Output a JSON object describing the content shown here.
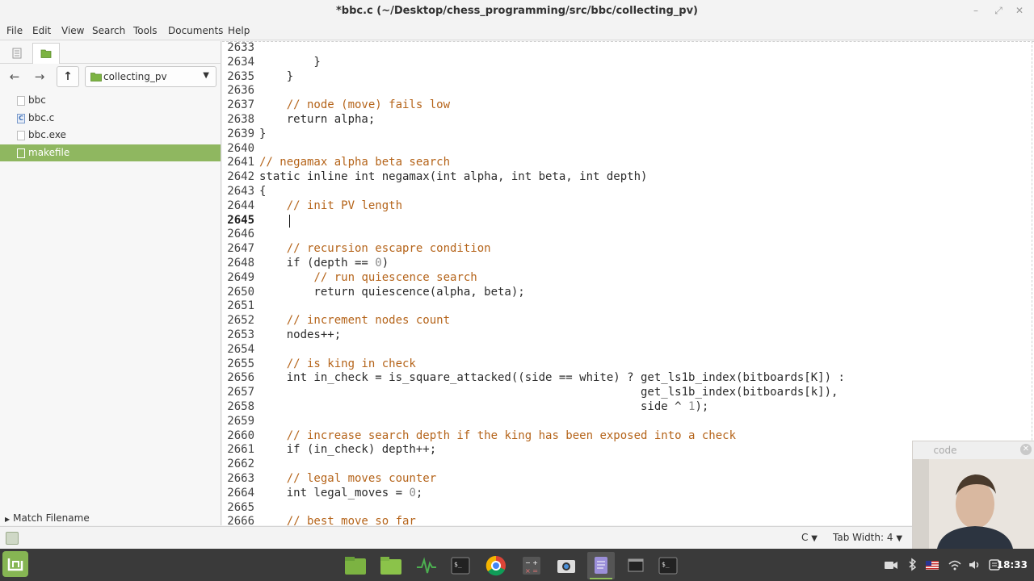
{
  "window": {
    "title": "*bbc.c (~/Desktop/chess_programming/src/bbc/collecting_pv)",
    "min_glyph": "–",
    "max_glyph": "⤢",
    "close_glyph": "✕"
  },
  "menu": {
    "file": "File",
    "edit": "Edit",
    "view": "View",
    "search": "Search",
    "tools": "Tools",
    "documents": "Documents",
    "help": "Help"
  },
  "sidebar": {
    "nav": {
      "back": "←",
      "forward": "→",
      "up": "↑"
    },
    "folder": "collecting_pv",
    "files": [
      {
        "name": "bbc",
        "icon": "blank-file-icon"
      },
      {
        "name": "bbc.c",
        "icon": "c-file-icon"
      },
      {
        "name": "bbc.exe",
        "icon": "blank-file-icon"
      },
      {
        "name": "makefile",
        "icon": "makefile-icon",
        "selected": true
      }
    ],
    "match_filename": "Match Filename",
    "accent": "#8fb760"
  },
  "editor": {
    "lines": [
      {
        "n": "2633",
        "t": ""
      },
      {
        "n": "2634",
        "t": "        }"
      },
      {
        "n": "2635",
        "t": "    }"
      },
      {
        "n": "2636",
        "t": ""
      },
      {
        "n": "2637",
        "t": "    // node (move) fails low"
      },
      {
        "n": "2638",
        "t": "    return alpha;"
      },
      {
        "n": "2639",
        "t": "}"
      },
      {
        "n": "2640",
        "t": ""
      },
      {
        "n": "2641",
        "t": "// negamax alpha beta search"
      },
      {
        "n": "2642",
        "t": "static inline int negamax(int alpha, int beta, int depth)"
      },
      {
        "n": "2643",
        "t": "{"
      },
      {
        "n": "2644",
        "t": "    // init PV length"
      },
      {
        "n": "2645",
        "t": "    ",
        "current": true
      },
      {
        "n": "2646",
        "t": ""
      },
      {
        "n": "2647",
        "t": "    // recursion escapre condition"
      },
      {
        "n": "2648",
        "t": "    if (depth == 0)"
      },
      {
        "n": "2649",
        "t": "        // run quiescence search"
      },
      {
        "n": "2650",
        "t": "        return quiescence(alpha, beta);"
      },
      {
        "n": "2651",
        "t": ""
      },
      {
        "n": "2652",
        "t": "    // increment nodes count"
      },
      {
        "n": "2653",
        "t": "    nodes++;"
      },
      {
        "n": "2654",
        "t": ""
      },
      {
        "n": "2655",
        "t": "    // is king in check"
      },
      {
        "n": "2656",
        "t": "    int in_check = is_square_attacked((side == white) ? get_ls1b_index(bitboards[K]) :"
      },
      {
        "n": "2657",
        "t": "                                                        get_ls1b_index(bitboards[k]),"
      },
      {
        "n": "2658",
        "t": "                                                        side ^ 1);"
      },
      {
        "n": "2659",
        "t": ""
      },
      {
        "n": "2660",
        "t": "    // increase search depth if the king has been exposed into a check"
      },
      {
        "n": "2661",
        "t": "    if (in_check) depth++;"
      },
      {
        "n": "2662",
        "t": ""
      },
      {
        "n": "2663",
        "t": "    // legal moves counter"
      },
      {
        "n": "2664",
        "t": "    int legal_moves = 0;"
      },
      {
        "n": "2665",
        "t": ""
      },
      {
        "n": "2666",
        "t": "    // best move so far"
      }
    ],
    "comment_color": "#b5641a",
    "number_color": "#8a8a8a"
  },
  "statusbar": {
    "language": "C",
    "tab_width": "Tab Width: 4"
  },
  "webcam": {
    "title": "code",
    "close": "✕"
  },
  "taskbar": {
    "apps": [
      "files-green-icon",
      "folder-icon",
      "system-monitor-icon",
      "terminal-icon",
      "chrome-icon",
      "calculator-icon",
      "screenshot-icon",
      "text-editor-icon",
      "window-icon",
      "terminal-icon"
    ],
    "clock": "18:33"
  }
}
